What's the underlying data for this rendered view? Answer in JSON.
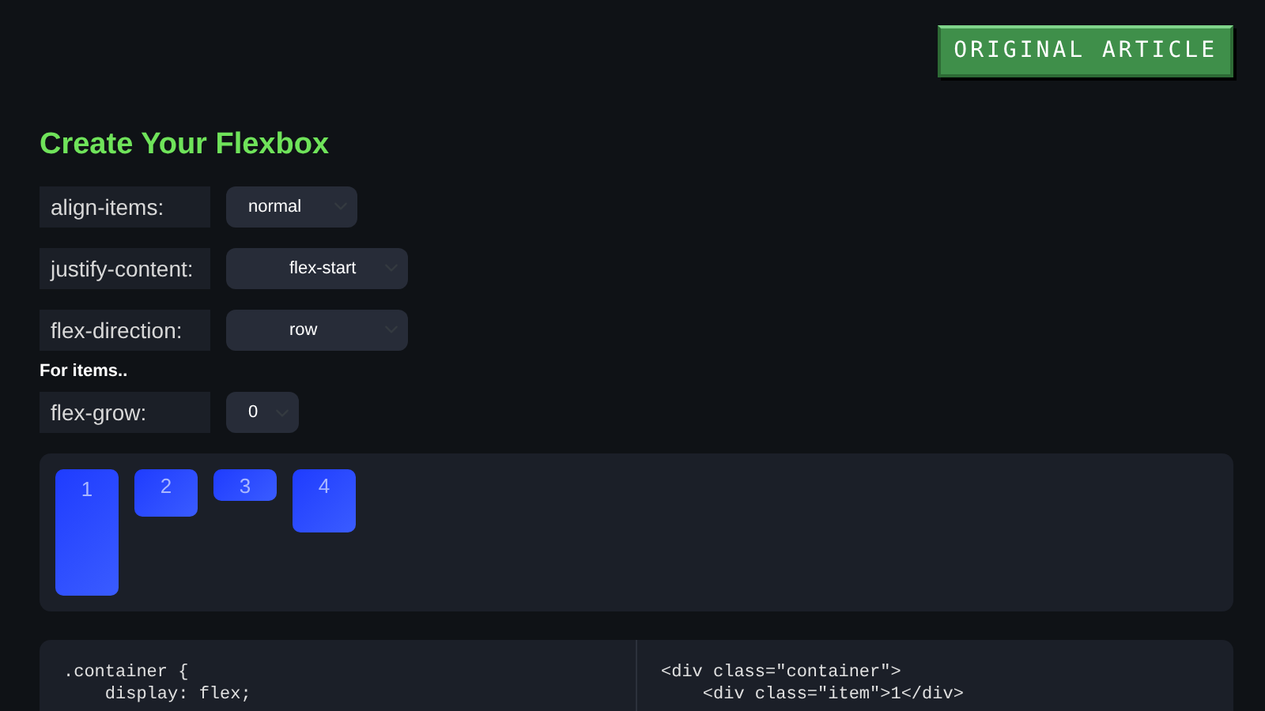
{
  "article_button": "ORIGINAL ARTICLE",
  "title": "Create Your Flexbox",
  "container_controls": [
    {
      "label": "align-items:",
      "value": "normal"
    },
    {
      "label": "justify-content:",
      "value": "flex-start"
    },
    {
      "label": "flex-direction:",
      "value": "row"
    }
  ],
  "items_heading": "For items..",
  "item_controls": [
    {
      "label": "flex-grow:",
      "value": "0"
    }
  ],
  "preview_items": [
    "1",
    "2",
    "3",
    "4"
  ],
  "css_code": [
    ".container {",
    "    display: flex;"
  ],
  "html_code": [
    "<div class=\"container\">",
    "    <div class=\"item\">1</div>"
  ]
}
